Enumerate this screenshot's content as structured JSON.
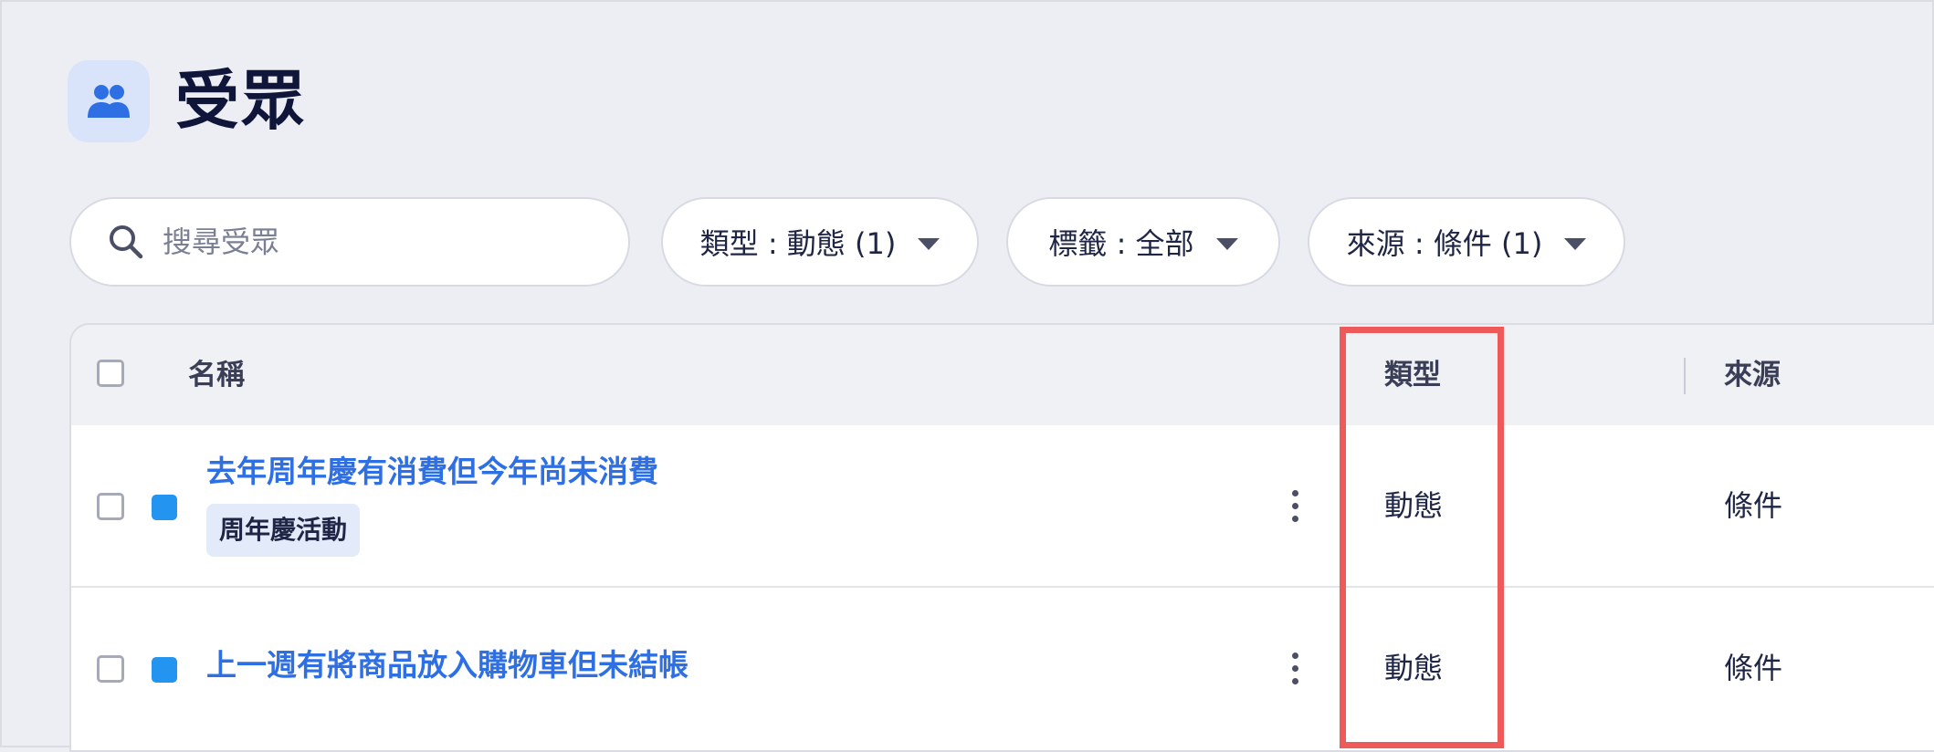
{
  "page": {
    "title": "受眾",
    "icon": "audience-group-icon"
  },
  "search": {
    "placeholder": "搜尋受眾",
    "value": ""
  },
  "filters": [
    {
      "label": "類型 : 動態 (1)",
      "icon": "caret-down-icon"
    },
    {
      "label": "標籤 : 全部",
      "icon": "caret-down-icon"
    },
    {
      "label": "來源 : 條件 (1)",
      "icon": "caret-down-icon"
    }
  ],
  "table": {
    "columns": {
      "name": "名稱",
      "type": "類型",
      "source": "來源"
    },
    "rows": [
      {
        "name": "去年周年慶有消費但今年尚未消費",
        "tag": "周年慶活動",
        "type": "動態",
        "source": "條件",
        "swatch_color": "#2394f0"
      },
      {
        "name": "上一週有將商品放入購物車但未結帳",
        "type": "動態",
        "source": "條件",
        "swatch_color": "#2394f0"
      }
    ]
  },
  "colors": {
    "accent": "#2f6fe4",
    "highlight": "#ee5a5a",
    "background": "#eceef3"
  }
}
